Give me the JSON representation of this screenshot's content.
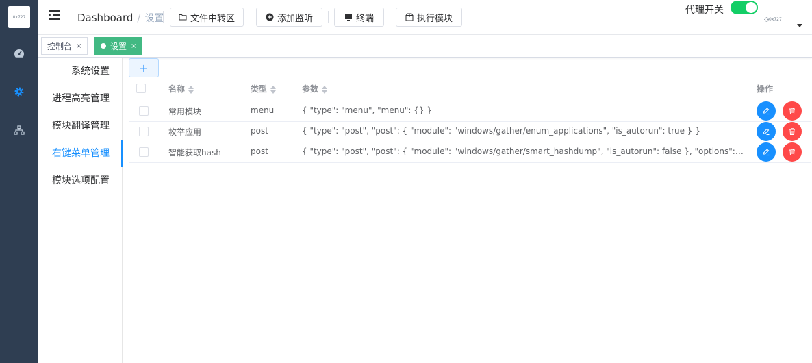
{
  "app": {
    "logo_text": "0x727"
  },
  "rail": {
    "items": [
      {
        "icon": "dashboard-icon",
        "active": false
      },
      {
        "icon": "gear-icon",
        "active": true
      },
      {
        "icon": "network-icon",
        "active": false
      }
    ]
  },
  "header": {
    "breadcrumb": {
      "root": "Dashboard",
      "separator": "/",
      "current": "设置"
    },
    "buttons": {
      "file_transfer": "文件中转区",
      "add_listener": "添加监听",
      "terminal": "终端",
      "run_module": "执行模块"
    },
    "proxy_switch_label": "代理开关",
    "proxy_switch_on": true,
    "avatar_text": "0x727"
  },
  "tags": [
    {
      "label": "控制台",
      "close": "×",
      "active": false
    },
    {
      "label": "设置",
      "close": "×",
      "active": true
    }
  ],
  "settings_menu": {
    "items": [
      "系统设置",
      "进程高亮管理",
      "模块翻译管理",
      "右键菜单管理",
      "模块选项配置"
    ],
    "active_index": 3
  },
  "toolbar": {
    "add_label": "+"
  },
  "table": {
    "headers": {
      "name": "名称",
      "type": "类型",
      "params": "参数",
      "actions": "操作"
    },
    "rows": [
      {
        "name": "常用模块",
        "type": "menu",
        "params": "{ \"type\": \"menu\", \"menu\": {} }"
      },
      {
        "name": "枚举应用",
        "type": "post",
        "params": "{ \"type\": \"post\", \"post\": { \"module\": \"windows/gather/enum_applications\", \"is_autorun\": true } }"
      },
      {
        "name": "智能获取hash",
        "type": "post",
        "params": "{ \"type\": \"post\", \"post\": { \"module\": \"windows/gather/smart_hashdump\", \"is_autorun\": false }, \"options\": { \"GETSYSTEM\"..."
      }
    ]
  },
  "colors": {
    "rail_bg": "#2f3e52",
    "active_blue": "#1890ff",
    "tag_green": "#42b983",
    "switch_green": "#13ce66",
    "danger_red": "#ff4949"
  }
}
